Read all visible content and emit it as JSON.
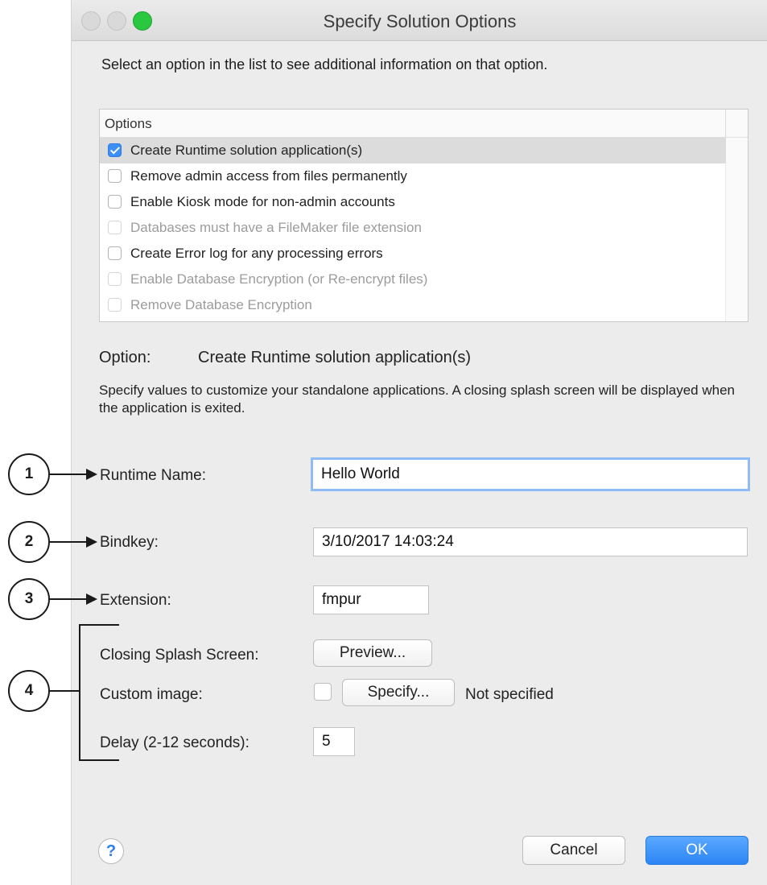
{
  "window": {
    "title": "Specify Solution Options"
  },
  "intro_text": "Select an option in the list to see additional information on that option.",
  "options_list": {
    "header": "Options",
    "items": [
      {
        "label": "Create Runtime solution application(s)",
        "checked": true,
        "enabled": true,
        "selected": true
      },
      {
        "label": "Remove admin access from files permanently",
        "checked": false,
        "enabled": true,
        "selected": false
      },
      {
        "label": "Enable Kiosk mode for non-admin accounts",
        "checked": false,
        "enabled": true,
        "selected": false
      },
      {
        "label": "Databases must have a FileMaker file extension",
        "checked": false,
        "enabled": false,
        "selected": false
      },
      {
        "label": "Create Error log for any processing errors",
        "checked": false,
        "enabled": true,
        "selected": false
      },
      {
        "label": "Enable Database Encryption (or Re-encrypt files)",
        "checked": false,
        "enabled": false,
        "selected": false
      },
      {
        "label": "Remove Database Encryption",
        "checked": false,
        "enabled": false,
        "selected": false
      }
    ]
  },
  "option_detail": {
    "key": "Option:",
    "value": "Create Runtime solution application(s)",
    "description": "Specify values to customize your standalone applications. A closing splash screen will be displayed when the application is exited."
  },
  "form": {
    "runtime_name_label": "Runtime Name:",
    "runtime_name_value": "Hello World",
    "bindkey_label": "Bindkey:",
    "bindkey_value": "3/10/2017 14:03:24",
    "extension_label": "Extension:",
    "extension_value": "fmpur",
    "closing_splash_label": "Closing Splash Screen:",
    "preview_button": "Preview...",
    "custom_image_label": "Custom image:",
    "specify_button": "Specify...",
    "custom_image_status": "Not specified",
    "delay_label": "Delay (2-12 seconds):",
    "delay_value": "5"
  },
  "footer": {
    "help_symbol": "?",
    "cancel_button": "Cancel",
    "ok_button": "OK"
  },
  "callouts": [
    "1",
    "2",
    "3",
    "4"
  ],
  "colors": {
    "accent": "#2d86f5",
    "checkbox_checked": "#3d8ef7",
    "focus_ring": "#8fbcf5"
  }
}
